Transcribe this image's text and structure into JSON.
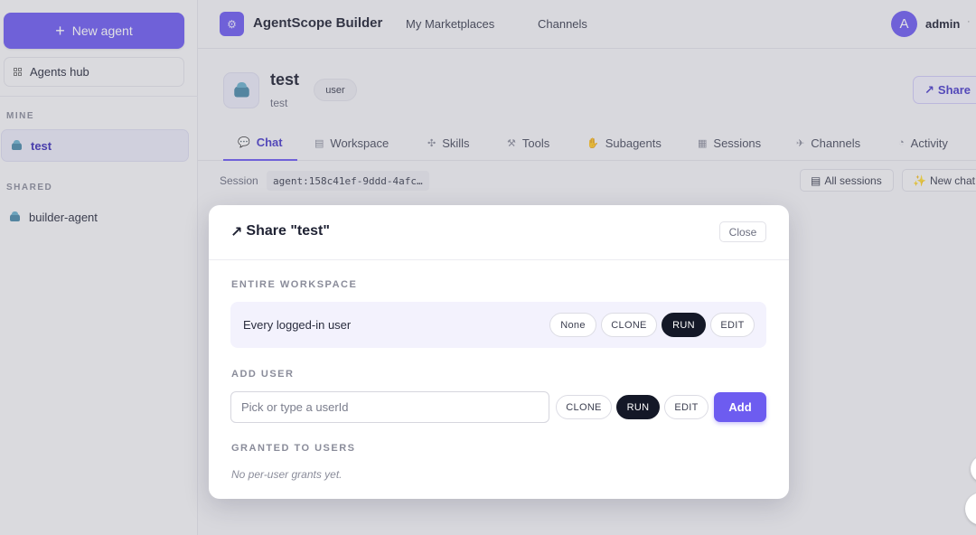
{
  "sidebar": {
    "new_agent": "New agent",
    "hub": "Agents hub",
    "mine_label": "MINE",
    "mine_items": [
      {
        "label": "test"
      }
    ],
    "shared_label": "SHARED",
    "shared_items": [
      {
        "label": "builder-agent"
      }
    ]
  },
  "topbar": {
    "brand": "AgentScope Builder",
    "nav": [
      "My Marketplaces",
      "Channels"
    ],
    "user_initial": "A",
    "user_name": "admin"
  },
  "agent": {
    "name": "test",
    "subtitle": "test",
    "role": "user",
    "share_label": "Share"
  },
  "tabs": [
    {
      "label": "Chat",
      "icon": "chat-icon"
    },
    {
      "label": "Workspace",
      "icon": "folder-icon"
    },
    {
      "label": "Skills",
      "icon": "puzzle-icon"
    },
    {
      "label": "Tools",
      "icon": "tools-icon"
    },
    {
      "label": "Subagents",
      "icon": "handshake-icon"
    },
    {
      "label": "Sessions",
      "icon": "list-icon"
    },
    {
      "label": "Channels",
      "icon": "satellite-icon"
    },
    {
      "label": "Activity",
      "icon": "clock-icon"
    }
  ],
  "session": {
    "label": "Session",
    "id": "agent:158c41ef-9ddd-4afc…",
    "all_sessions": "All sessions",
    "new_chat": "New chat"
  },
  "modal": {
    "title": "Share \"test\"",
    "close": "Close",
    "workspace_label": "ENTIRE WORKSPACE",
    "workspace_row": "Every logged-in user",
    "workspace_options": [
      "None",
      "CLONE",
      "RUN",
      "EDIT"
    ],
    "workspace_selected": "RUN",
    "add_user_label": "ADD USER",
    "user_placeholder": "Pick or type a userId",
    "user_options": [
      "CLONE",
      "RUN",
      "EDIT"
    ],
    "user_selected": "RUN",
    "add": "Add",
    "granted_label": "GRANTED TO USERS",
    "granted_empty": "No per-user grants yet."
  }
}
